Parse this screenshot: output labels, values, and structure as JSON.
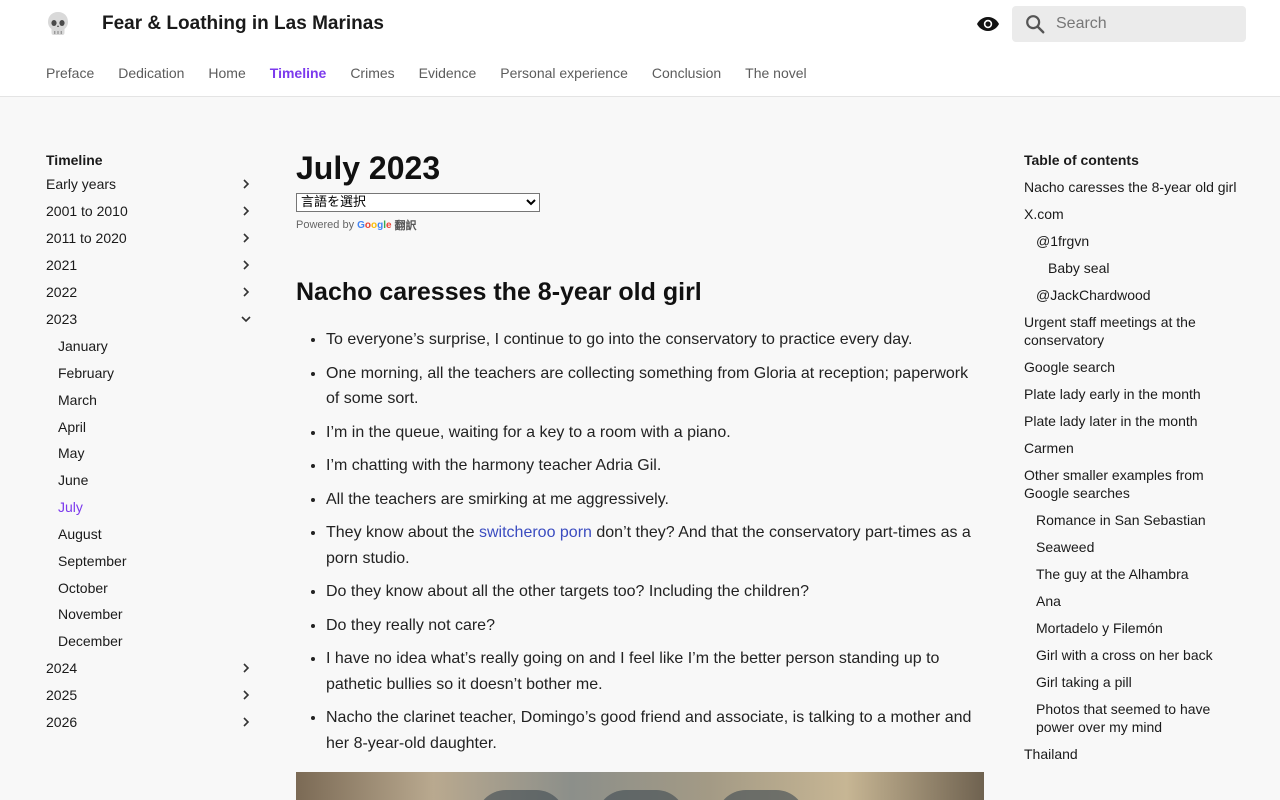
{
  "site": {
    "title": "Fear & Loathing in Las Marinas"
  },
  "search": {
    "placeholder": "Search"
  },
  "nav": [
    {
      "label": "Preface",
      "active": false
    },
    {
      "label": "Dedication",
      "active": false
    },
    {
      "label": "Home",
      "active": false
    },
    {
      "label": "Timeline",
      "active": true
    },
    {
      "label": "Crimes",
      "active": false
    },
    {
      "label": "Evidence",
      "active": false
    },
    {
      "label": "Personal experience",
      "active": false
    },
    {
      "label": "Conclusion",
      "active": false
    },
    {
      "label": "The novel",
      "active": false
    }
  ],
  "sidebar": {
    "heading": "Timeline",
    "items_before": [
      "Early years",
      "2001 to 2010",
      "2011 to 2020",
      "2021",
      "2022"
    ],
    "expanded": "2023",
    "months": [
      "January",
      "February",
      "March",
      "April",
      "May",
      "June",
      "July",
      "August",
      "September",
      "October",
      "November",
      "December"
    ],
    "active_month": "July",
    "items_after": [
      "2024",
      "2025",
      "2026"
    ]
  },
  "main": {
    "title": "July 2023",
    "translate_select": "言語を選択",
    "powered_by": "Powered by",
    "google_letters": [
      "G",
      "o",
      "o",
      "g",
      "l",
      "e"
    ],
    "translate_word": "翻訳",
    "section_heading": "Nacho caresses the 8-year old girl",
    "bullets": [
      {
        "text": "To everyone’s surprise, I continue to go into the conservatory to practice every day."
      },
      {
        "text": "One morning, all the teachers are collecting something from Gloria at reception; paperwork of some sort."
      },
      {
        "text": "I’m in the queue, waiting for a key to a room with a piano."
      },
      {
        "text": "I’m chatting with the harmony teacher Adria Gil."
      },
      {
        "text": "All the teachers are smirking at me aggressively."
      },
      {
        "before": "They know about the ",
        "link": "switcheroo porn",
        "after": " don’t they? And that the conservatory part-times as a porn studio."
      },
      {
        "text": "Do they know about all the other targets too? Including the children?"
      },
      {
        "text": "Do they really not care?"
      },
      {
        "text": "I have no idea what’s really going on and I feel like I’m the better person standing up to pathetic bullies so it doesn’t bother me."
      },
      {
        "text": "Nacho the clarinet teacher, Domingo’s good friend and associate, is talking to a mother and her 8-year-old daughter."
      }
    ]
  },
  "toc": {
    "heading": "Table of contents",
    "items": [
      {
        "label": "Nacho caresses the 8-year old girl",
        "level": 1
      },
      {
        "label": "X.com",
        "level": 1
      },
      {
        "label": "@1frgvn",
        "level": 2
      },
      {
        "label": "Baby seal",
        "level": 3
      },
      {
        "label": "@JackChardwood",
        "level": 2
      },
      {
        "label": "Urgent staff meetings at the conservatory",
        "level": 1
      },
      {
        "label": "Google search",
        "level": 1
      },
      {
        "label": "Plate lady early in the month",
        "level": 1
      },
      {
        "label": "Plate lady later in the month",
        "level": 1
      },
      {
        "label": "Carmen",
        "level": 1
      },
      {
        "label": "Other smaller examples from Google searches",
        "level": 1
      },
      {
        "label": "Romance in San Sebastian",
        "level": 2
      },
      {
        "label": "Seaweed",
        "level": 2
      },
      {
        "label": "The guy at the Alhambra",
        "level": 2
      },
      {
        "label": "Ana",
        "level": 2
      },
      {
        "label": "Mortadelo y Filemón",
        "level": 2
      },
      {
        "label": "Girl with a cross on her back",
        "level": 2
      },
      {
        "label": "Girl taking a pill",
        "level": 2
      },
      {
        "label": "Photos that seemed to have power over my mind",
        "level": 2
      },
      {
        "label": "Thailand",
        "level": 1
      }
    ]
  },
  "colors": {
    "accent": "#7c3aed",
    "link": "#3b4cc0"
  }
}
